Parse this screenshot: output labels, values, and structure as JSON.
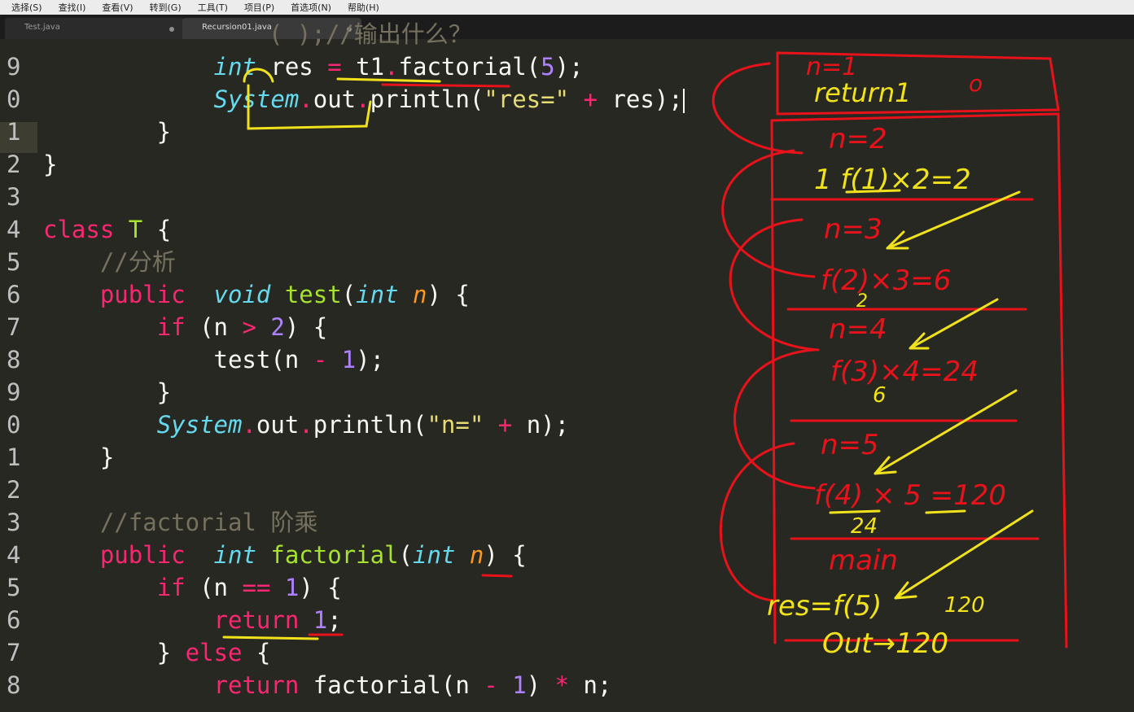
{
  "menu": [
    "选择(S)",
    "查找(I)",
    "查看(V)",
    "转到(G)",
    "工具(T)",
    "项目(P)",
    "首选项(N)",
    "帮助(H)"
  ],
  "tabs": [
    {
      "label": "Test.java",
      "active": false
    },
    {
      "label": "Recursion01.java",
      "active": true
    }
  ],
  "code": {
    "partial_top": "( );//输出什么？",
    "lines": [
      {
        "num": "9",
        "tokens": [
          [
            "",
            "            "
          ],
          [
            "ty",
            "int"
          ],
          [
            "",
            " res "
          ],
          [
            "kw",
            "="
          ],
          [
            "",
            " t1"
          ],
          [
            "kw",
            "."
          ],
          [
            "",
            "factorial("
          ],
          [
            "num",
            "5"
          ],
          [
            "",
            ");"
          ]
        ]
      },
      {
        "num": "0",
        "tokens": [
          [
            "",
            "            "
          ],
          [
            "ty",
            "System"
          ],
          [
            "kw",
            "."
          ],
          [
            "",
            "out"
          ],
          [
            "kw",
            "."
          ],
          [
            "",
            "println("
          ],
          [
            "str",
            "\"res=\""
          ],
          [
            "",
            " "
          ],
          [
            "kw",
            "+"
          ],
          [
            "",
            " res);"
          ]
        ],
        "cursor": true
      },
      {
        "num": "1",
        "tokens": [
          [
            "",
            "        }"
          ]
        ]
      },
      {
        "num": "2",
        "tokens": [
          [
            "",
            "}"
          ]
        ]
      },
      {
        "num": "3",
        "tokens": []
      },
      {
        "num": "4",
        "tokens": [
          [
            "kw",
            "class"
          ],
          [
            "",
            " "
          ],
          [
            "fn",
            "T"
          ],
          [
            "",
            " {"
          ]
        ]
      },
      {
        "num": "5",
        "tokens": [
          [
            "",
            "    "
          ],
          [
            "cm",
            "//分析"
          ]
        ]
      },
      {
        "num": "6",
        "tokens": [
          [
            "",
            "    "
          ],
          [
            "kw",
            "public"
          ],
          [
            "",
            "  "
          ],
          [
            "ty",
            "void"
          ],
          [
            "",
            " "
          ],
          [
            "fn",
            "test"
          ],
          [
            "",
            "("
          ],
          [
            "ty",
            "int"
          ],
          [
            "",
            " "
          ],
          [
            "param",
            "n"
          ],
          [
            "",
            ") {"
          ]
        ]
      },
      {
        "num": "7",
        "tokens": [
          [
            "",
            "        "
          ],
          [
            "kw",
            "if"
          ],
          [
            "",
            " (n "
          ],
          [
            "kw",
            ">"
          ],
          [
            "",
            " "
          ],
          [
            "num",
            "2"
          ],
          [
            "",
            ") {"
          ]
        ]
      },
      {
        "num": "8",
        "tokens": [
          [
            "",
            "            test(n "
          ],
          [
            "kw",
            "-"
          ],
          [
            "",
            " "
          ],
          [
            "num",
            "1"
          ],
          [
            "",
            ");"
          ]
        ]
      },
      {
        "num": "9",
        "tokens": [
          [
            "",
            "        }"
          ]
        ]
      },
      {
        "num": "0",
        "tokens": [
          [
            "",
            "        "
          ],
          [
            "ty",
            "System"
          ],
          [
            "kw",
            "."
          ],
          [
            "",
            "out"
          ],
          [
            "kw",
            "."
          ],
          [
            "",
            "println("
          ],
          [
            "str",
            "\"n=\""
          ],
          [
            "",
            " "
          ],
          [
            "kw",
            "+"
          ],
          [
            "",
            " n);"
          ]
        ]
      },
      {
        "num": "1",
        "tokens": [
          [
            "",
            "    }"
          ]
        ]
      },
      {
        "num": "2",
        "tokens": []
      },
      {
        "num": "3",
        "tokens": [
          [
            "",
            "    "
          ],
          [
            "cm",
            "//factorial 阶乘"
          ]
        ]
      },
      {
        "num": "4",
        "tokens": [
          [
            "",
            "    "
          ],
          [
            "kw",
            "public"
          ],
          [
            "",
            "  "
          ],
          [
            "ty",
            "int"
          ],
          [
            "",
            " "
          ],
          [
            "fn",
            "factorial"
          ],
          [
            "",
            "("
          ],
          [
            "ty",
            "int"
          ],
          [
            "",
            " "
          ],
          [
            "param",
            "n"
          ],
          [
            "",
            ") {"
          ]
        ]
      },
      {
        "num": "5",
        "tokens": [
          [
            "",
            "        "
          ],
          [
            "kw",
            "if"
          ],
          [
            "",
            " (n "
          ],
          [
            "kw",
            "=="
          ],
          [
            "",
            " "
          ],
          [
            "num",
            "1"
          ],
          [
            "",
            ") {"
          ]
        ]
      },
      {
        "num": "6",
        "tokens": [
          [
            "",
            "            "
          ],
          [
            "kw",
            "return"
          ],
          [
            "",
            " "
          ],
          [
            "num",
            "1"
          ],
          [
            "",
            ";"
          ]
        ]
      },
      {
        "num": "7",
        "tokens": [
          [
            "",
            "        } "
          ],
          [
            "kw",
            "else"
          ],
          [
            "",
            " {"
          ]
        ]
      },
      {
        "num": "8",
        "tokens": [
          [
            "",
            "            "
          ],
          [
            "kw",
            "return"
          ],
          [
            "",
            " factorial(n "
          ],
          [
            "kw",
            "-"
          ],
          [
            "",
            " "
          ],
          [
            "num",
            "1"
          ],
          [
            "",
            ") "
          ],
          [
            "kw",
            "*"
          ],
          [
            "",
            " n;"
          ]
        ]
      }
    ]
  },
  "annotations": {
    "frames": [
      {
        "label": "n=1",
        "body": "return1"
      },
      {
        "label": "n=2",
        "body": "1 f(1)×2=2"
      },
      {
        "label": "n=3",
        "body": "f(2)×3=6",
        "sub": "2"
      },
      {
        "label": "n=4",
        "body": "f(3)×4=24",
        "sub": "6"
      },
      {
        "label": "n=5",
        "body": "f(4) × 5 =120",
        "sub": "24"
      },
      {
        "label": "main",
        "body": "res=f(5)",
        "extra": "120"
      }
    ],
    "out": "Out→120",
    "colors": {
      "red": "#e8121b",
      "yellow": "#f2e21b"
    }
  }
}
